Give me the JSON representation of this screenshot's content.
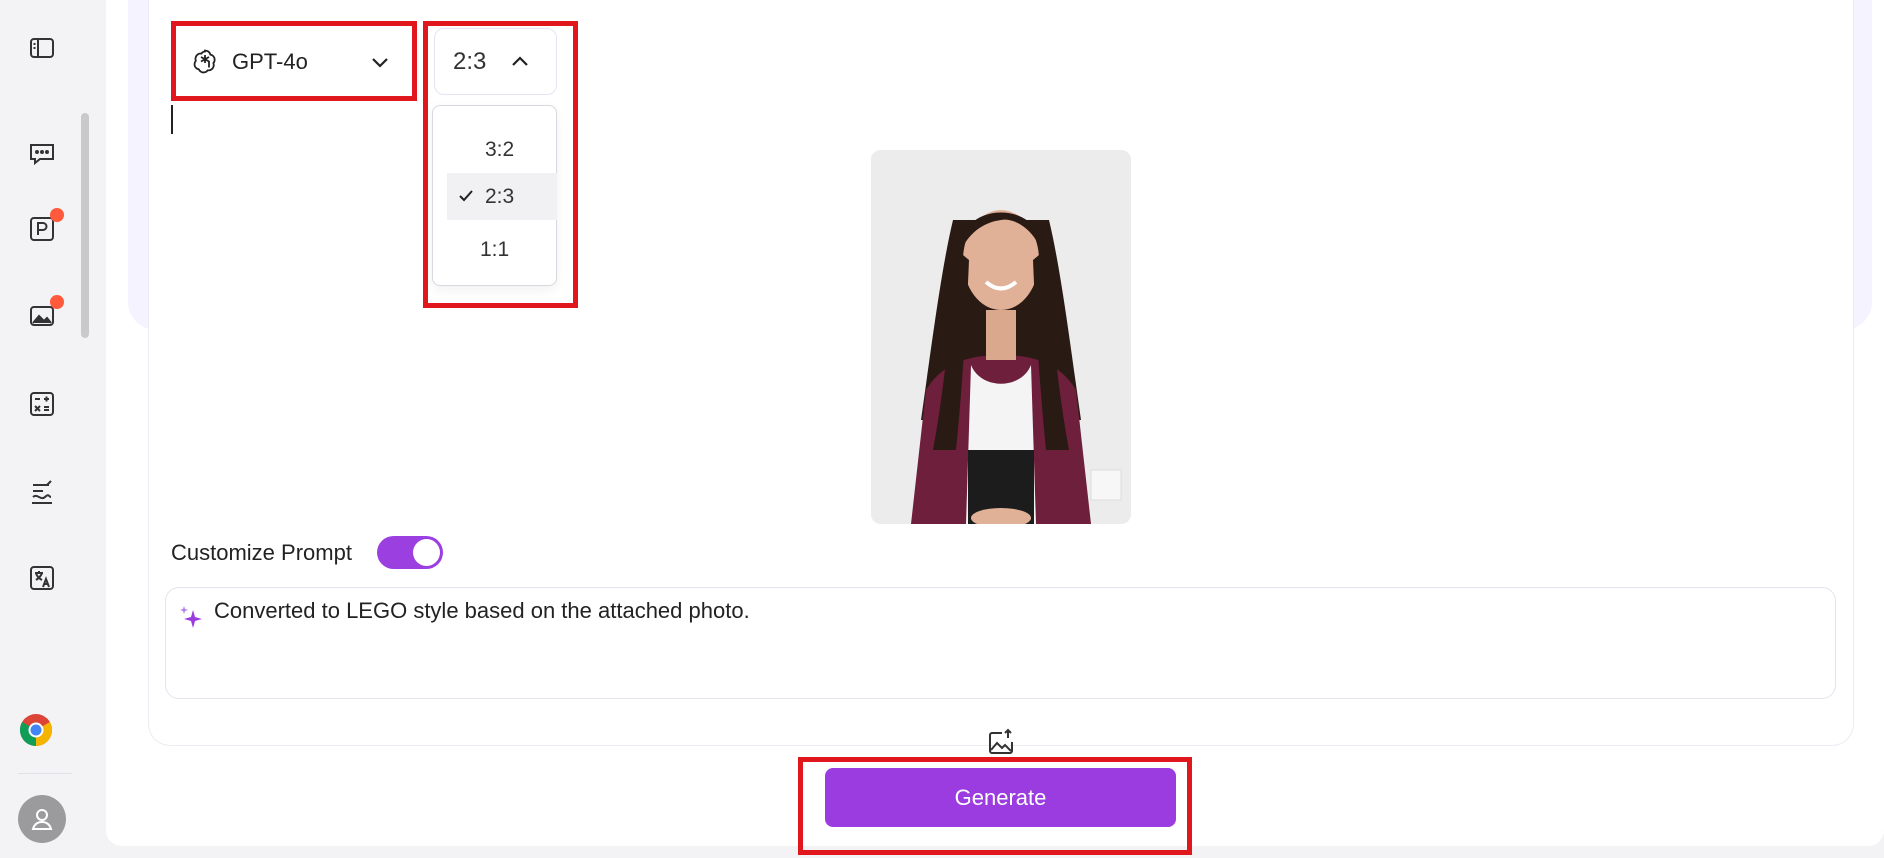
{
  "sidebar": {
    "items": [
      {
        "icon": "sidebar-toggle-icon"
      },
      {
        "icon": "chat-icon"
      },
      {
        "icon": "ppt-icon",
        "hot": true
      },
      {
        "icon": "image-icon",
        "hot": true
      },
      {
        "icon": "calculator-icon"
      },
      {
        "icon": "write-icon"
      },
      {
        "icon": "translate-icon"
      }
    ],
    "bottom": [
      {
        "icon": "chrome-icon"
      },
      {
        "icon": "avatar-icon"
      }
    ]
  },
  "toolbar": {
    "model": "GPT-4o",
    "ratio": "2:3"
  },
  "ratio_menu": {
    "options": [
      "3:2",
      "2:3",
      "1:1"
    ],
    "selected": "2:3"
  },
  "customize": {
    "label": "Customize Prompt",
    "enabled": true
  },
  "prompt": {
    "text": "Converted to LEGO style based on the attached photo."
  },
  "actions": {
    "generate_label": "Generate"
  },
  "colors": {
    "accent": "#9a3cdf",
    "highlight": "#e0171d",
    "hot": "#ff5a3c"
  }
}
